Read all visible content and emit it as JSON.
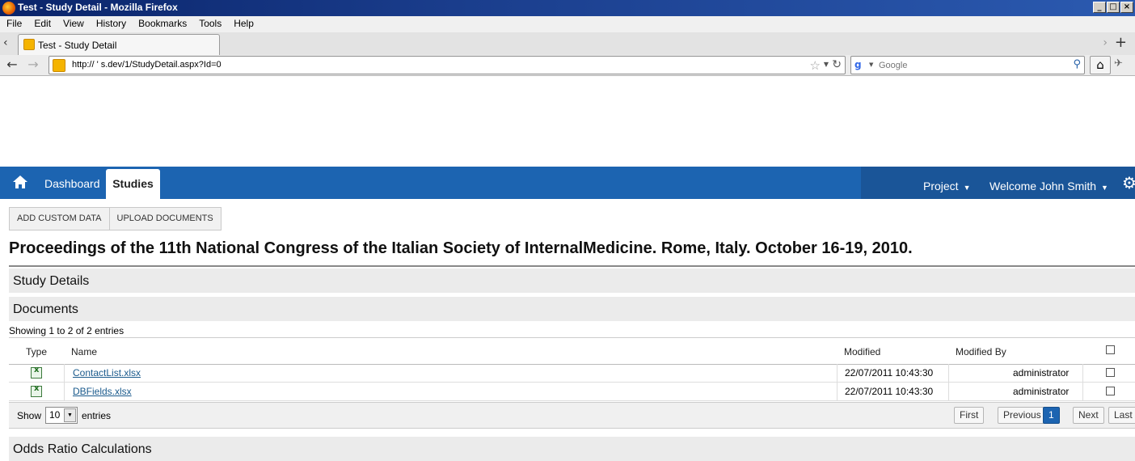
{
  "window": {
    "title": "Test - Study Detail - Mozilla Firefox"
  },
  "menu": [
    "File",
    "Edit",
    "View",
    "History",
    "Bookmarks",
    "Tools",
    "Help"
  ],
  "tab": {
    "label": "Test - Study Detail"
  },
  "urlbar": {
    "url": "http://  '             s.dev/1/StudyDetail.aspx?Id=0"
  },
  "searchbar": {
    "placeholder": "Google"
  },
  "appnav": {
    "dashboard": "Dashboard",
    "studies": "Studies",
    "project": "Project",
    "welcome": "Welcome John Smith"
  },
  "actions": {
    "add_custom": "ADD CUSTOM DATA",
    "upload": "UPLOAD DOCUMENTS"
  },
  "study": {
    "title": "Proceedings of the 11th National Congress of the Italian Society of InternalMedicine. Rome, Italy. October 16-19, 2010."
  },
  "sections": {
    "details": "Study Details",
    "documents": "Documents",
    "odds": "Odds Ratio Calculations"
  },
  "documents": {
    "info": "Showing 1 to 2 of 2 entries",
    "columns": {
      "type": "Type",
      "name": "Name",
      "modified": "Modified",
      "modified_by": "Modified By"
    },
    "rows": [
      {
        "name": "ContactList.xlsx",
        "modified": "22/07/2011 10:43:30",
        "modified_by": "administrator"
      },
      {
        "name": "DBFields.xlsx",
        "modified": "22/07/2011 10:43:30",
        "modified_by": "administrator"
      }
    ],
    "show_label": "Show",
    "page_size": "10",
    "entries_label": "entries",
    "pager": {
      "first": "First",
      "previous": "Previous",
      "current": "1",
      "next": "Next",
      "last": "Last"
    }
  },
  "colors": {
    "appbar": "#1c64b1",
    "appbar_right": "#1a5598",
    "link": "#1a5a8c"
  }
}
